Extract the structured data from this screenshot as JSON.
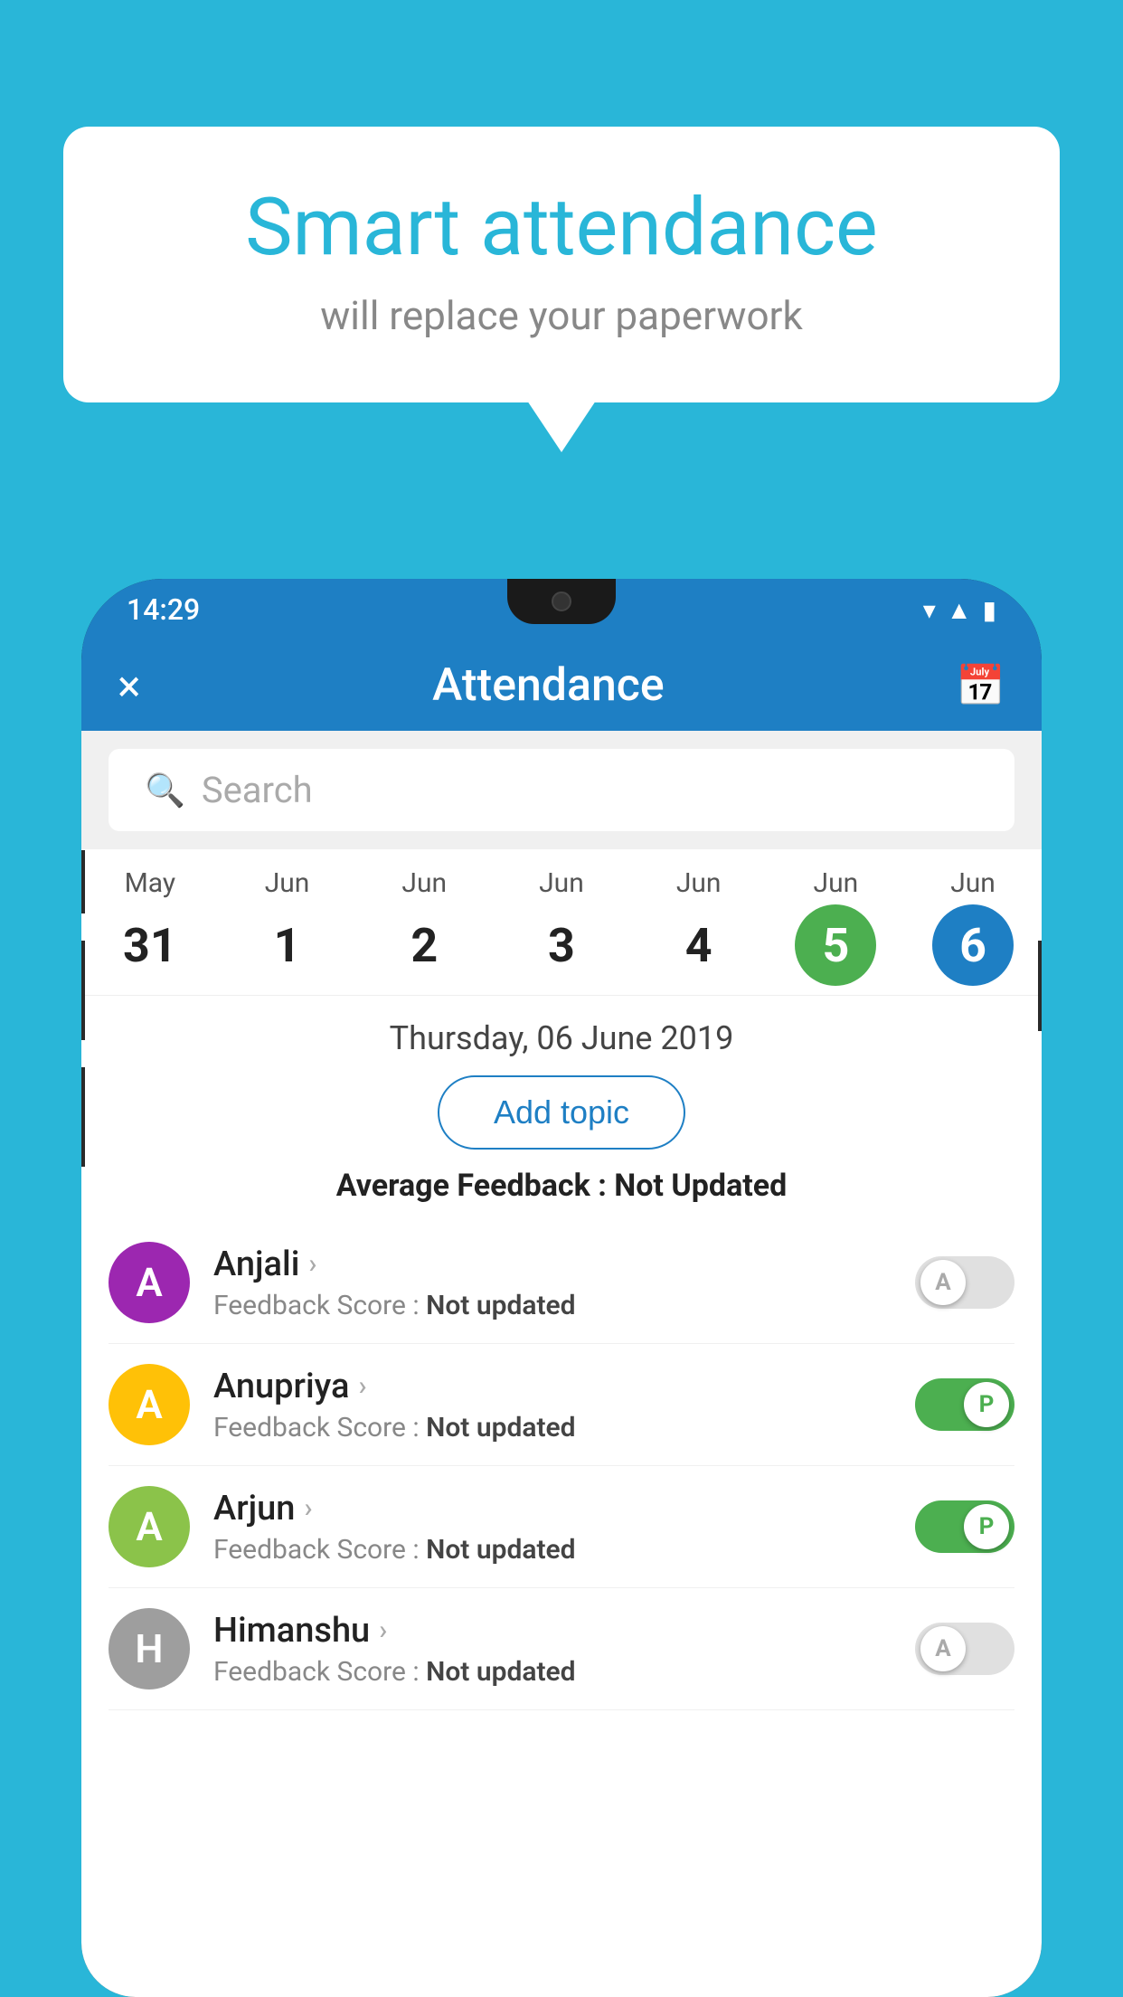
{
  "background_color": "#29b6d8",
  "speech_bubble": {
    "title": "Smart attendance",
    "subtitle": "will replace your paperwork"
  },
  "phone": {
    "status_bar": {
      "time": "14:29",
      "icons": [
        "wifi",
        "signal",
        "battery"
      ]
    },
    "header": {
      "close_label": "×",
      "title": "Attendance",
      "calendar_icon": "calendar"
    },
    "search": {
      "placeholder": "Search"
    },
    "calendar": {
      "days": [
        {
          "month": "May",
          "date": "31",
          "state": "normal"
        },
        {
          "month": "Jun",
          "date": "1",
          "state": "normal"
        },
        {
          "month": "Jun",
          "date": "2",
          "state": "normal"
        },
        {
          "month": "Jun",
          "date": "3",
          "state": "normal"
        },
        {
          "month": "Jun",
          "date": "4",
          "state": "normal"
        },
        {
          "month": "Jun",
          "date": "5",
          "state": "today"
        },
        {
          "month": "Jun",
          "date": "6",
          "state": "selected"
        }
      ]
    },
    "selected_date": "Thursday, 06 June 2019",
    "add_topic_label": "Add topic",
    "avg_feedback_label": "Average Feedback :",
    "avg_feedback_value": "Not Updated",
    "students": [
      {
        "name": "Anjali",
        "avatar_letter": "A",
        "avatar_color": "#9c27b0",
        "feedback_label": "Feedback Score :",
        "feedback_value": "Not updated",
        "toggle_state": "off",
        "toggle_label": "A"
      },
      {
        "name": "Anupriya",
        "avatar_letter": "A",
        "avatar_color": "#ffc107",
        "feedback_label": "Feedback Score :",
        "feedback_value": "Not updated",
        "toggle_state": "on",
        "toggle_label": "P"
      },
      {
        "name": "Arjun",
        "avatar_letter": "A",
        "avatar_color": "#8bc34a",
        "feedback_label": "Feedback Score :",
        "feedback_value": "Not updated",
        "toggle_state": "on",
        "toggle_label": "P"
      },
      {
        "name": "Himanshu",
        "avatar_letter": "H",
        "avatar_color": "#9e9e9e",
        "feedback_label": "Feedback Score :",
        "feedback_value": "Not updated",
        "toggle_state": "off",
        "toggle_label": "A"
      }
    ]
  }
}
